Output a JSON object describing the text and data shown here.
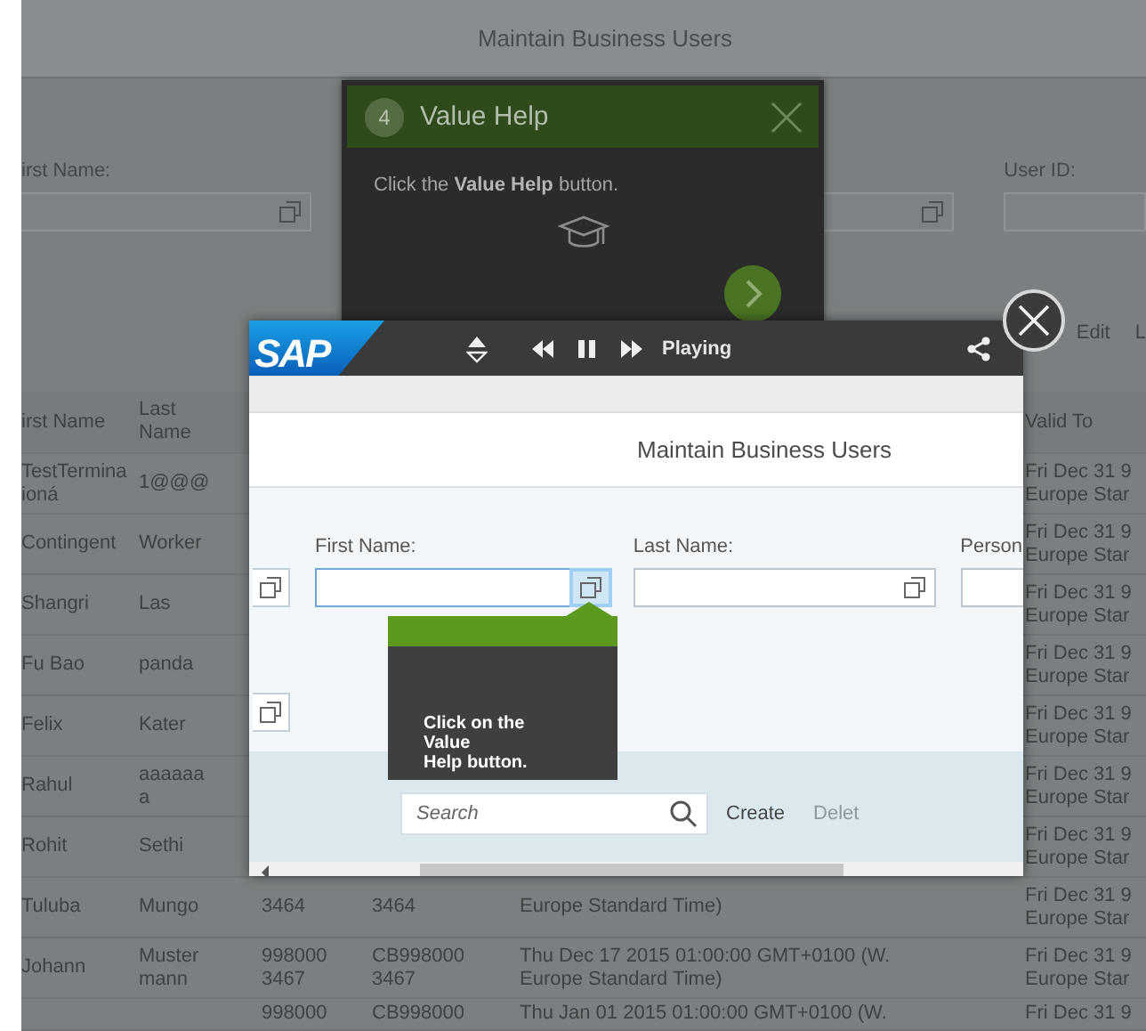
{
  "page": {
    "title": "Maintain Business Users",
    "filters": [
      {
        "label": "irst Name:",
        "value_help": true
      },
      {
        "value_help": true
      },
      {
        "label": "User ID:"
      }
    ],
    "actions": [
      "Edit",
      "L"
    ],
    "table": {
      "header": {
        "first_name": "irst Name",
        "last_name": "Last\nName",
        "valid_to": "Valid To"
      },
      "rows": [
        {
          "first_name": "TestTermina\nioná",
          "last_name": "1@@@",
          "valid_to": "Fri Dec 31 9\nEurope Star"
        },
        {
          "first_name": "Contingent",
          "last_name": "Worker",
          "valid_to": "Fri Dec 31 9\nEurope Star"
        },
        {
          "first_name": "Shangri",
          "last_name": "Las",
          "valid_to": "Fri Dec 31 9\nEurope Star"
        },
        {
          "first_name": "Fu Bao",
          "last_name": "panda",
          "valid_to": "Fri Dec 31 9\nEurope Star"
        },
        {
          "first_name": "Felix",
          "last_name": "Kater",
          "valid_to": "Fri Dec 31 9\nEurope Star"
        },
        {
          "first_name": "Rahul",
          "last_name": "aaaaaa\na",
          "valid_to": "Fri Dec 31 9\nEurope Star"
        },
        {
          "first_name": "Rohit",
          "last_name": "Sethi",
          "valid_to": "Fri Dec 31 9\nEurope Star"
        },
        {
          "first_name": "Tuluba",
          "last_name": "Mungo",
          "column_3": "3464",
          "column_4": "3464",
          "column_5": "Europe Standard Time)",
          "valid_to": "Fri Dec 31 9\nEurope Star"
        },
        {
          "first_name": "Johann",
          "last_name": "Muster\nmann",
          "column_3": "998000\n3467",
          "column_4": "CB998000\n3467",
          "column_5": "Thu Dec 17 2015 01:00:00 GMT+0100 (W.\nEurope Standard Time)",
          "valid_to": "Fri Dec 31 9\nEurope Star"
        },
        {
          "column_3": "998000",
          "column_4": "CB998000",
          "column_5": "Thu Jan 01 2015 01:00:00 GMT+0100 (W.",
          "valid_to": "Fri Dec 31 9"
        }
      ]
    }
  },
  "tutorial": {
    "step": "4",
    "title": "Value Help",
    "text": "Click the **Value Help** button."
  },
  "player": {
    "logo": "SAP",
    "playing": true,
    "status": "Playing",
    "screen": {
      "title": "Maintain Business Users",
      "fields": [
        {
          "label": "First Name:",
          "value_help": true,
          "highlighted": true
        },
        {
          "label": "Last Name:",
          "value_help": true,
          "highlighted": false
        },
        {
          "label": "Person"
        }
      ],
      "callout": "Click on the\nValue\nHelp button.",
      "search": {
        "placeholder": "Search"
      },
      "actions": [
        {
          "label": "Create",
          "disabled": false
        },
        {
          "label": "Delet",
          "disabled": true
        }
      ]
    }
  }
}
